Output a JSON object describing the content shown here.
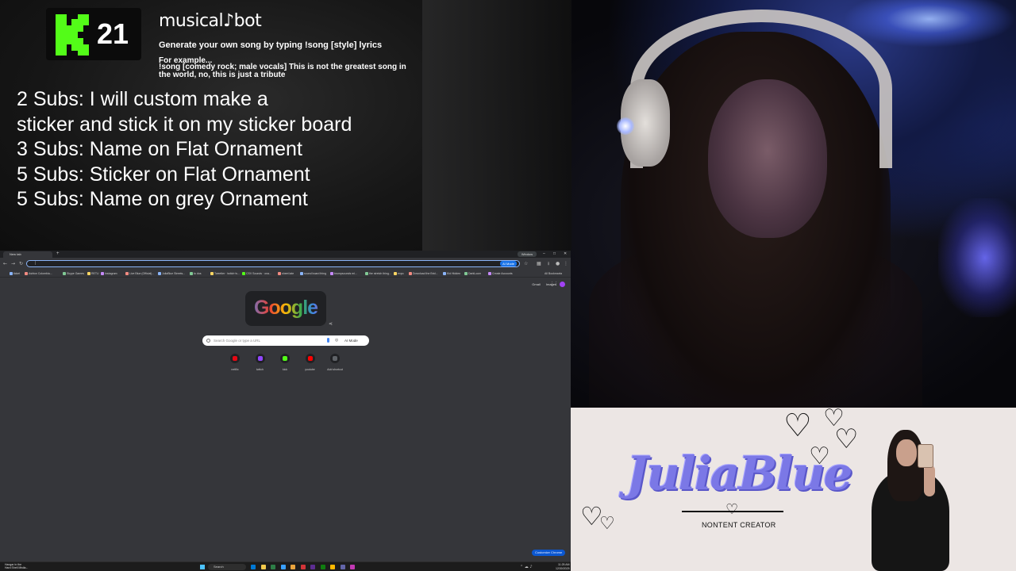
{
  "overlay": {
    "kick_count": "21",
    "kick_color": "#53fc18",
    "bot_title": "musical♪bot",
    "bot_subtitle": "Generate your own song by typing !song [style] lyrics",
    "example_label": "For example...",
    "example_text": "!song [comedy rock; male vocals] This is not the greatest song in the world, no, this is just a tribute",
    "subs": [
      "2 Subs: I will custom make a",
      "sticker and stick it on my sticker board",
      "3 Subs: Name on Flat Ornament",
      "5 Subs: Sticker on Flat Ornament",
      "5 Subs: Name on grey Ornament"
    ]
  },
  "browser": {
    "tab_title": "New tab",
    "new_tab_glyph": "+",
    "window_badge": "Window",
    "omnibox_value": "|",
    "omnibox_ai_chip": "AI Mode",
    "bookmarks": [
      {
        "label": "ticket",
        "color": "#8ab4f8"
      },
      {
        "label": "Ashton Colombia...",
        "color": "#f28b82"
      },
      {
        "label": "Skype Games",
        "color": "#81c995"
      },
      {
        "label": "RETU",
        "color": "#fdd663"
      },
      {
        "label": "Instagram",
        "color": "#c58af9"
      },
      {
        "label": "Live Blue (Official)...",
        "color": "#f28b82"
      },
      {
        "label": "JuliaBlue Streets...",
        "color": "#8ab4f8"
      },
      {
        "label": "to dos",
        "color": "#81c995"
      },
      {
        "label": "Tweetier · twitch·tv...",
        "color": "#fdd663"
      },
      {
        "label": "CSV Sounds · ona...",
        "color": "#53fc18"
      },
      {
        "label": "sheet late",
        "color": "#f28b82"
      },
      {
        "label": "sound board thing",
        "color": "#8ab4f8"
      },
      {
        "label": "brumpsounds mi...",
        "color": "#c58af9"
      },
      {
        "label": "the stretch thing...",
        "color": "#81c995"
      },
      {
        "label": "expo",
        "color": "#fdd663"
      },
      {
        "label": "Download the Brid...",
        "color": "#f28b82"
      },
      {
        "label": "Kid Hidden",
        "color": "#8ab4f8"
      },
      {
        "label": "DarkLoom",
        "color": "#81c995"
      },
      {
        "label": "Create Accounts",
        "color": "#c58af9"
      }
    ],
    "all_bookmarks": "All Bookmarks",
    "ntp_links": [
      "Gmail",
      "Images"
    ],
    "doodle_text": "Google",
    "search_placeholder": "Search Google or type a URL",
    "search_ai_label": "AI Mode",
    "shortcuts": [
      {
        "label": "netflix",
        "color": "#e50914"
      },
      {
        "label": "twitch",
        "color": "#9146ff"
      },
      {
        "label": "kick",
        "color": "#53fc18"
      },
      {
        "label": "youtube",
        "color": "#ff0000"
      },
      {
        "label": "Add shortcut",
        "color": "#5f6368"
      }
    ],
    "customize_label": "Customize Chrome"
  },
  "taskbar": {
    "weather_line1": "Hangar in the",
    "weather_line2": "Hard Shell Mistla...",
    "search_label": "Search",
    "apps": [
      "#0078d4",
      "#f2c94c",
      "#2d7d46",
      "#3aa0ff",
      "#e8a33d",
      "#d13438",
      "#5c2d91",
      "#107c10",
      "#ffb900",
      "#6264a7",
      "#c239b3"
    ],
    "time": "11:25 AM",
    "date": "12/30/2025"
  },
  "brand": {
    "name": "JuliaBlue",
    "tagline": "NONTENT CREATOR",
    "accent": "#7b78e6"
  }
}
